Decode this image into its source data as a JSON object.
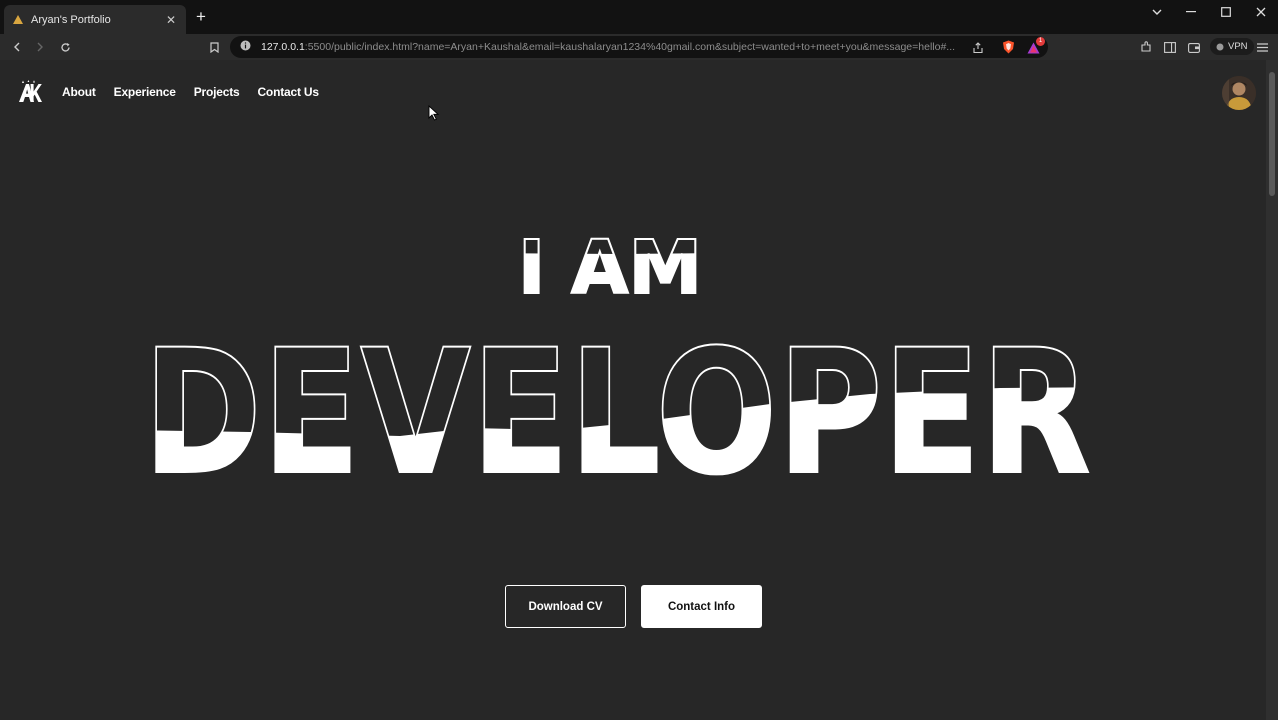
{
  "browser": {
    "tab_title": "Aryan's Portfolio",
    "tab_close": "✕",
    "new_tab": "+",
    "url_host": "127.0.0.1",
    "url_rest": ":5500/public/index.html?name=Aryan+Kaushal&email=kaushalaryan1234%40gmail.com&subject=wanted+to+meet+you&message=hello#...",
    "vpn_label": "VPN",
    "notification_count": "1"
  },
  "nav": {
    "logo_text": "AK",
    "items": [
      "About",
      "Experience",
      "Projects",
      "Contact Us"
    ]
  },
  "hero": {
    "line1": "I AM",
    "line2": "DEVELOPER"
  },
  "buttons": {
    "download": "Download CV",
    "contact": "Contact Info"
  },
  "colors": {
    "page_bg": "#272727",
    "text": "#ffffff"
  }
}
